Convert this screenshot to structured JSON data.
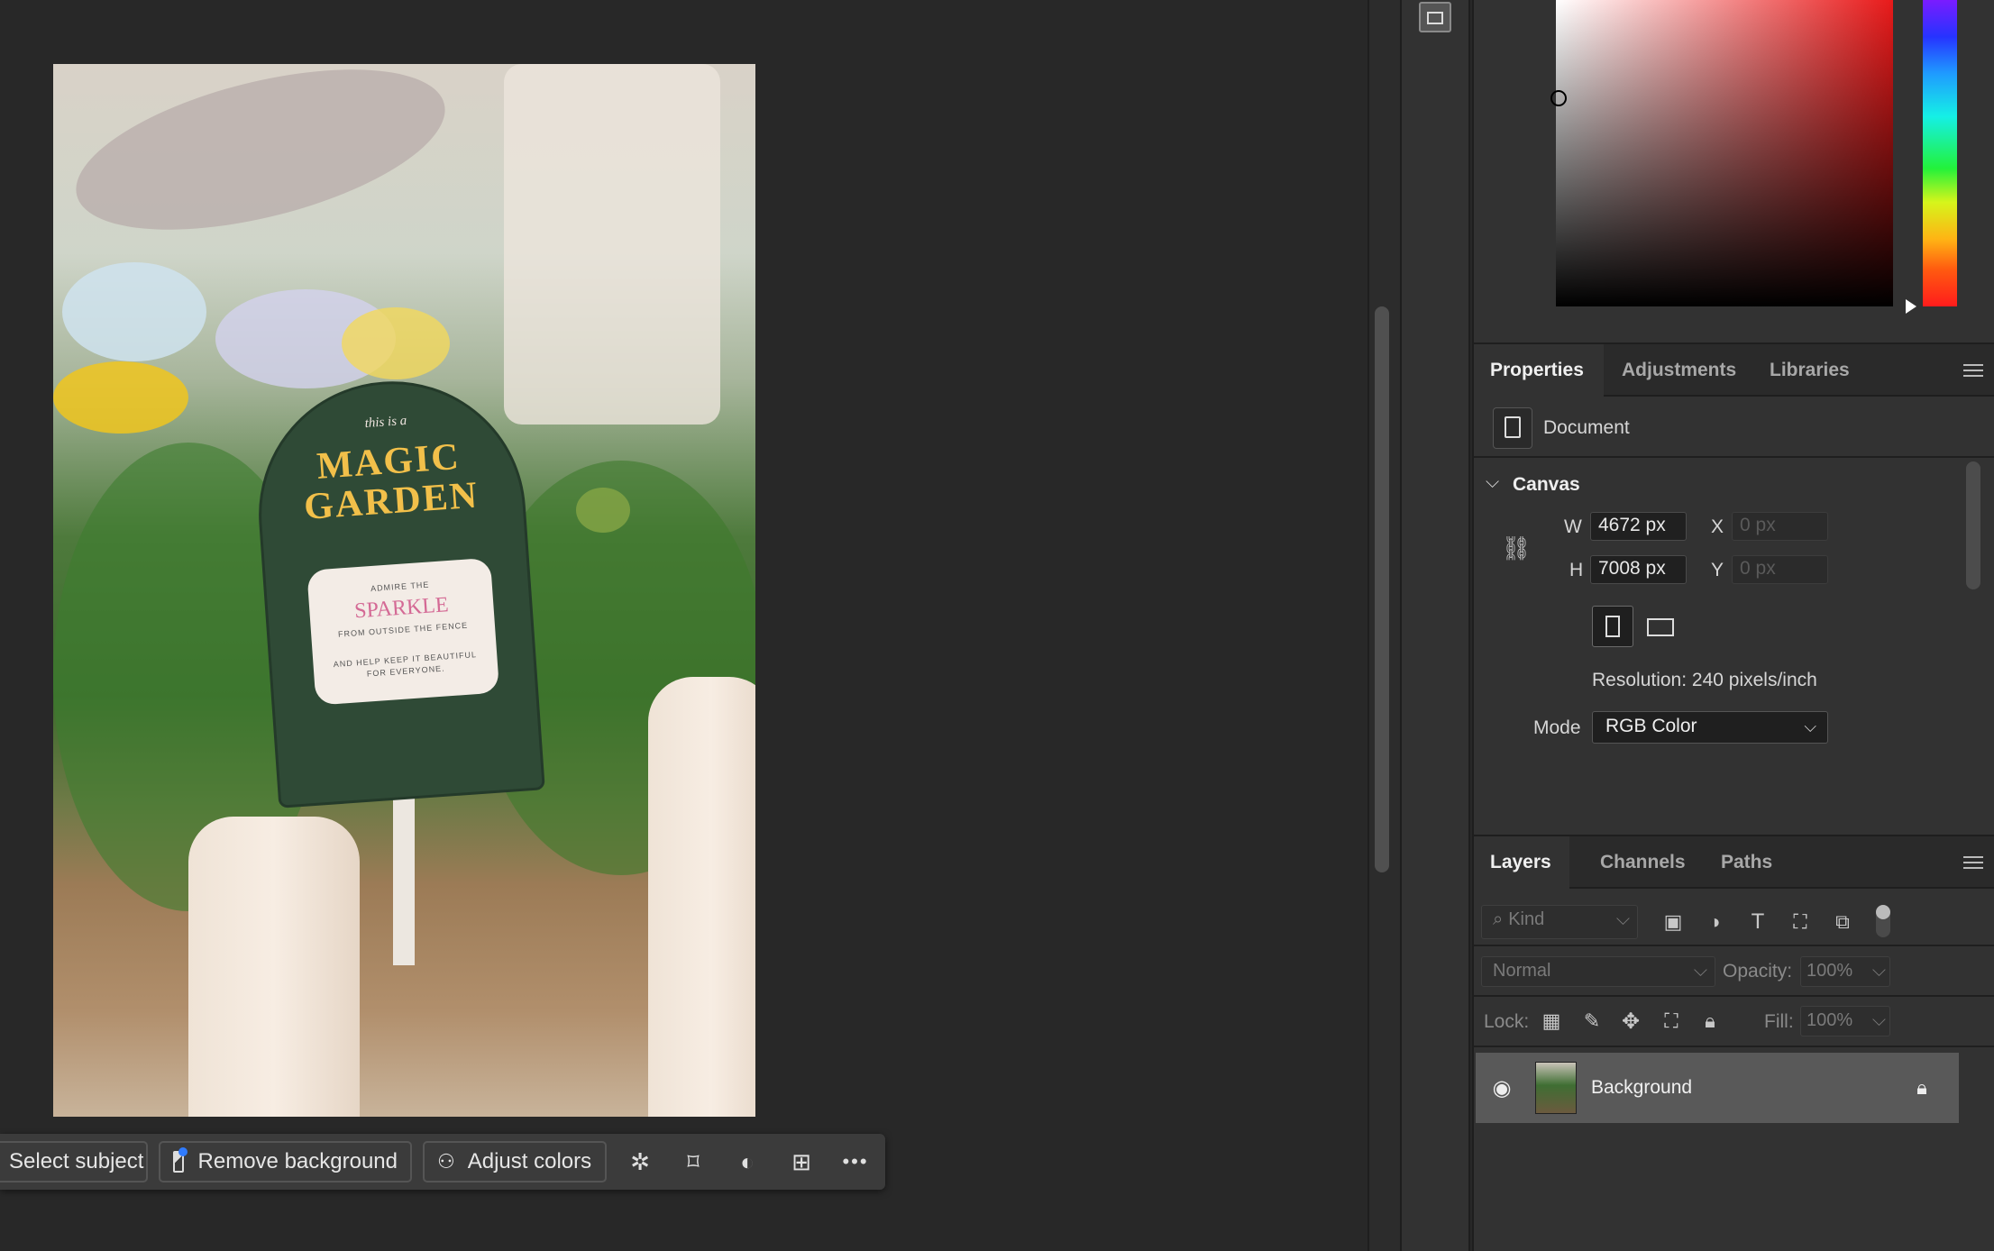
{
  "quick_actions": {
    "select_subject": "Select subject",
    "remove_background": "Remove background",
    "adjust_colors": "Adjust colors",
    "icons": [
      "magic-select-icon",
      "transform-icon",
      "contrast-icon",
      "generative-fill-icon",
      "more-icon"
    ],
    "more_glyph": "•••"
  },
  "sign_text": {
    "line1": "this is a",
    "line2": "MAGIC",
    "line3": "GARDEN",
    "plate1": "ADMIRE THE",
    "plate2": "SPARKLE",
    "plate3": "FROM OUTSIDE THE FENCE",
    "plate4": "AND HELP KEEP IT BEAUTIFUL FOR EVERYONE."
  },
  "properties_panel": {
    "tabs": [
      "Properties",
      "Adjustments",
      "Libraries"
    ],
    "active_tab": "Properties",
    "document_label": "Document",
    "canvas_section": "Canvas",
    "w_label": "W",
    "w_value": "4672 px",
    "h_label": "H",
    "h_value": "7008 px",
    "x_label": "X",
    "x_value": "0 px",
    "y_label": "Y",
    "y_value": "0 px",
    "resolution": "Resolution: 240 pixels/inch",
    "mode_label": "Mode",
    "mode_value": "RGB Color"
  },
  "layers_panel": {
    "tabs": [
      "Layers",
      "Channels",
      "Paths"
    ],
    "active_tab": "Layers",
    "filter_placeholder": "Kind",
    "blend_mode": "Normal",
    "opacity_label": "Opacity:",
    "opacity_value": "100%",
    "lock_label": "Lock:",
    "fill_label": "Fill:",
    "fill_value": "100%",
    "layers": [
      {
        "name": "Background",
        "visible": true,
        "locked": true
      }
    ]
  },
  "colors": {
    "accent_red": "#e81a1a",
    "panel_bg": "#323232",
    "workspace_bg": "#282828"
  }
}
